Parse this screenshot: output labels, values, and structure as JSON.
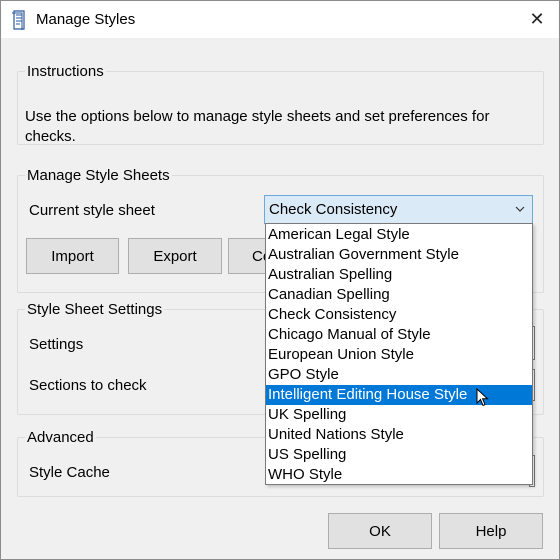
{
  "window": {
    "title": "Manage Styles",
    "close_glyph": "✕"
  },
  "instructions": {
    "legend": "Instructions",
    "text": "Use the options below to manage style sheets and set preferences for checks."
  },
  "manage": {
    "legend": "Manage Style Sheets",
    "current_label": "Current style sheet",
    "current_value": "Check Consistency",
    "import_label": "Import",
    "export_label": "Export",
    "third_label_partial": "Co"
  },
  "dropdown": {
    "options": [
      "American Legal Style",
      "Australian Government Style",
      "Australian Spelling",
      "Canadian Spelling",
      "Check Consistency",
      "Chicago Manual of Style",
      "European Union Style",
      "GPO Style",
      "Intelligent Editing House Style",
      "UK Spelling",
      "United Nations Style",
      "US Spelling",
      "WHO Style"
    ],
    "highlighted": "Intelligent Editing House Style"
  },
  "settings": {
    "legend": "Style Sheet Settings",
    "settings_label": "Settings",
    "sections_label": "Sections to check"
  },
  "advanced": {
    "legend": "Advanced",
    "cache_label": "Style Cache"
  },
  "footer": {
    "ok_label": "OK",
    "help_label": "Help"
  },
  "colors": {
    "selection": "#0078d7",
    "combo_focus_bg": "#dbeaf7",
    "combo_focus_border": "#6ea7d8"
  }
}
